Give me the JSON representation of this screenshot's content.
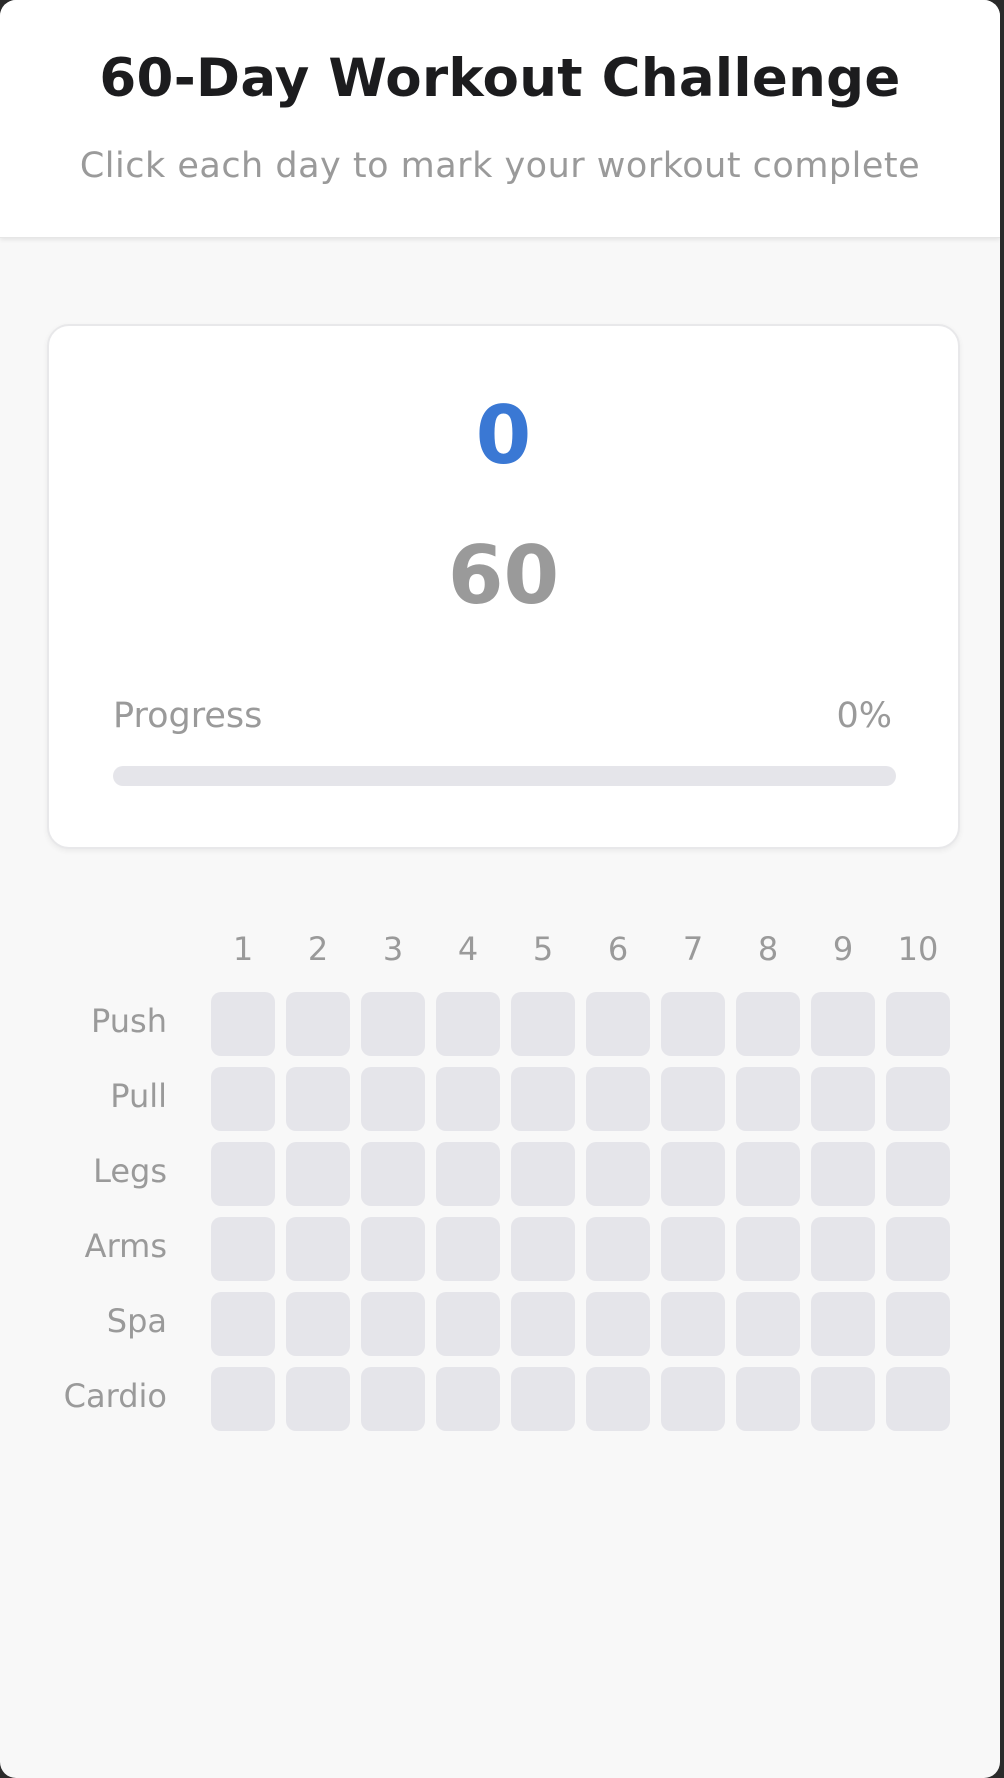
{
  "header": {
    "title": "60-Day Workout Challenge",
    "subtitle": "Click each day to mark your workout complete"
  },
  "stats": {
    "completed": "0",
    "total": "60",
    "progress_label": "Progress",
    "progress_text": "0%",
    "progress_fraction": 0
  },
  "grid": {
    "days": [
      "1",
      "2",
      "3",
      "4",
      "5",
      "6",
      "7",
      "8",
      "9",
      "10"
    ],
    "rows": [
      {
        "label": "Push"
      },
      {
        "label": "Pull"
      },
      {
        "label": "Legs"
      },
      {
        "label": "Arms"
      },
      {
        "label": "Spa"
      },
      {
        "label": "Cardio"
      }
    ]
  },
  "colors": {
    "accent": "#3a78d4",
    "cell_empty": "#e5e5ea",
    "muted_text": "#9a9a9a"
  }
}
